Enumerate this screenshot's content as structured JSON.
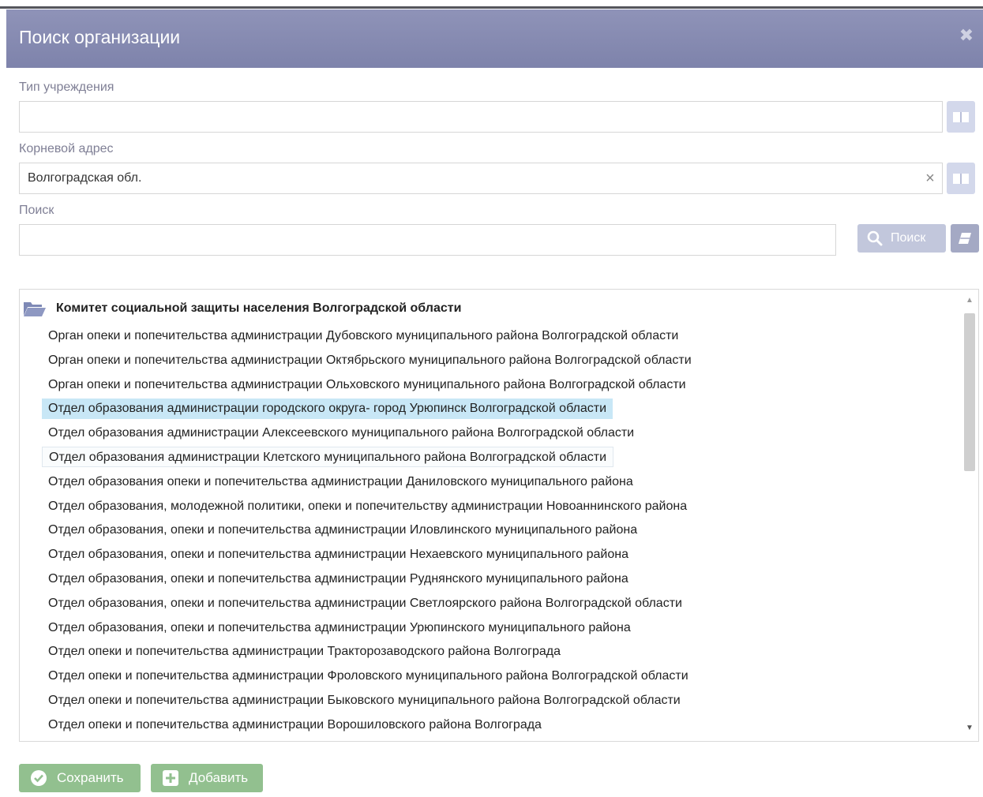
{
  "dialog": {
    "title": "Поиск организации",
    "close_icon": "close-icon"
  },
  "form": {
    "institution_type": {
      "label": "Тип учреждения",
      "value": ""
    },
    "root_address": {
      "label": "Корневой адрес",
      "value": "Волгоградская обл."
    },
    "search": {
      "label": "Поиск",
      "value": "",
      "button_label": "Поиск"
    }
  },
  "tree": {
    "root_label": "Комитет социальной защиты населения Волгоградской области",
    "items": [
      "Орган опеки и попечительства администрации Дубовского муниципального района Волгоградской области",
      "Орган опеки и попечительства администрации Октябрьского муниципального района Волгоградской области",
      "Орган опеки и попечительства администрации Ольховского муниципального района Волгоградской области",
      "Отдел образования администрации городского округа- город Урюпинск Волгоградской области",
      "Отдел образования администрации Алексеевского муниципального района Волгоградской области",
      "Отдел образования администрации Клетского муниципального района Волгоградской области",
      "Отдел образования опеки и попечительства администрации Даниловского муниципального района",
      "Отдел образования, молодежной политики, опеки и попечительству администрации Новоаннинского района",
      "Отдел образования, опеки и попечительства администрации Иловлинского муниципального района",
      "Отдел образования, опеки и попечительства администрации Нехаевского муниципального района",
      "Отдел образования, опеки и попечительства администрации Руднянского муниципального района",
      "Отдел образования, опеки и попечительства администрации Светлоярского района Волгоградской области",
      "Отдел образования, опеки и попечительства администрации Урюпинского муниципального района",
      "Отдел опеки и попечительства администрации Тракторозаводского района Волгограда",
      "Отдел опеки и попечительства администрации Фроловского муниципального района Волгоградской области",
      "Отдел опеки и попечительства администрации Быковского муниципального района Волгоградской области",
      "Отдел опеки и попечительства администрации Ворошиловского района Волгограда"
    ]
  },
  "footer": {
    "save_label": "Сохранить",
    "add_label": "Добавить"
  },
  "colors": {
    "header": "#8489b0",
    "selected_row": "#c8e7f6",
    "footer_button": "#92c08f",
    "dictionary_button": "#d3d8eb"
  }
}
